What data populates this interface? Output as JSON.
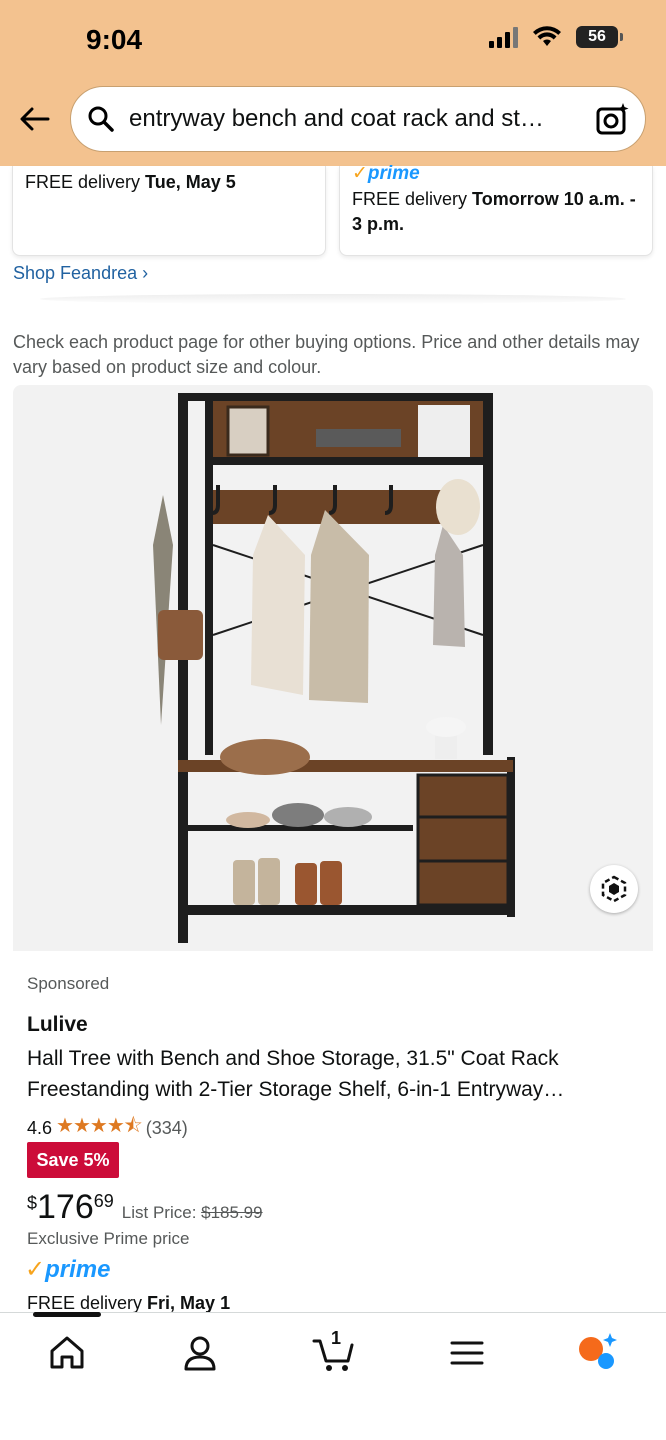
{
  "status_bar": {
    "time": "9:04",
    "battery": "56"
  },
  "search": {
    "query": "entryway bench and coat rack and st…"
  },
  "top_cards": {
    "left": {
      "delivery_prefix": "FREE delivery ",
      "delivery_date": "Tue, May 5"
    },
    "right": {
      "prime_label": "prime",
      "delivery_prefix": "FREE delivery ",
      "delivery_date": "Tomorrow 10 a.m. - 3 p.m."
    }
  },
  "shop_link": "Shop Feandrea ›",
  "notice": "Check each product page for other buying options. Price and other details may vary based on product size and colour.",
  "product": {
    "sponsored": "Sponsored",
    "brand": "Lulive",
    "title": "Hall Tree with Bench and Shoe Storage, 31.5\" Coat Rack Freestanding with 2-Tier Storage Shelf, 6-in-1 Entryway…",
    "rating": "4.6",
    "stars": "★★★★⯪",
    "review_count": "(334)",
    "save_badge": "Save 5%",
    "price_symbol": "$",
    "price_whole": "176",
    "price_fraction": "69",
    "list_price_label": "List Price: ",
    "list_price": "$185.99",
    "exclusive": "Exclusive Prime price",
    "prime_label": "prime",
    "delivery_prefix": "FREE delivery ",
    "delivery_date": "Fri, May 1"
  },
  "bottom_nav": {
    "cart_count": "1"
  },
  "colors": {
    "header_bg": "#f3c28f",
    "link": "#2162a1",
    "save_red": "#cc0c39",
    "star": "#de7921",
    "prime_blue": "#1a98ff",
    "prime_check": "#f7a41d"
  }
}
